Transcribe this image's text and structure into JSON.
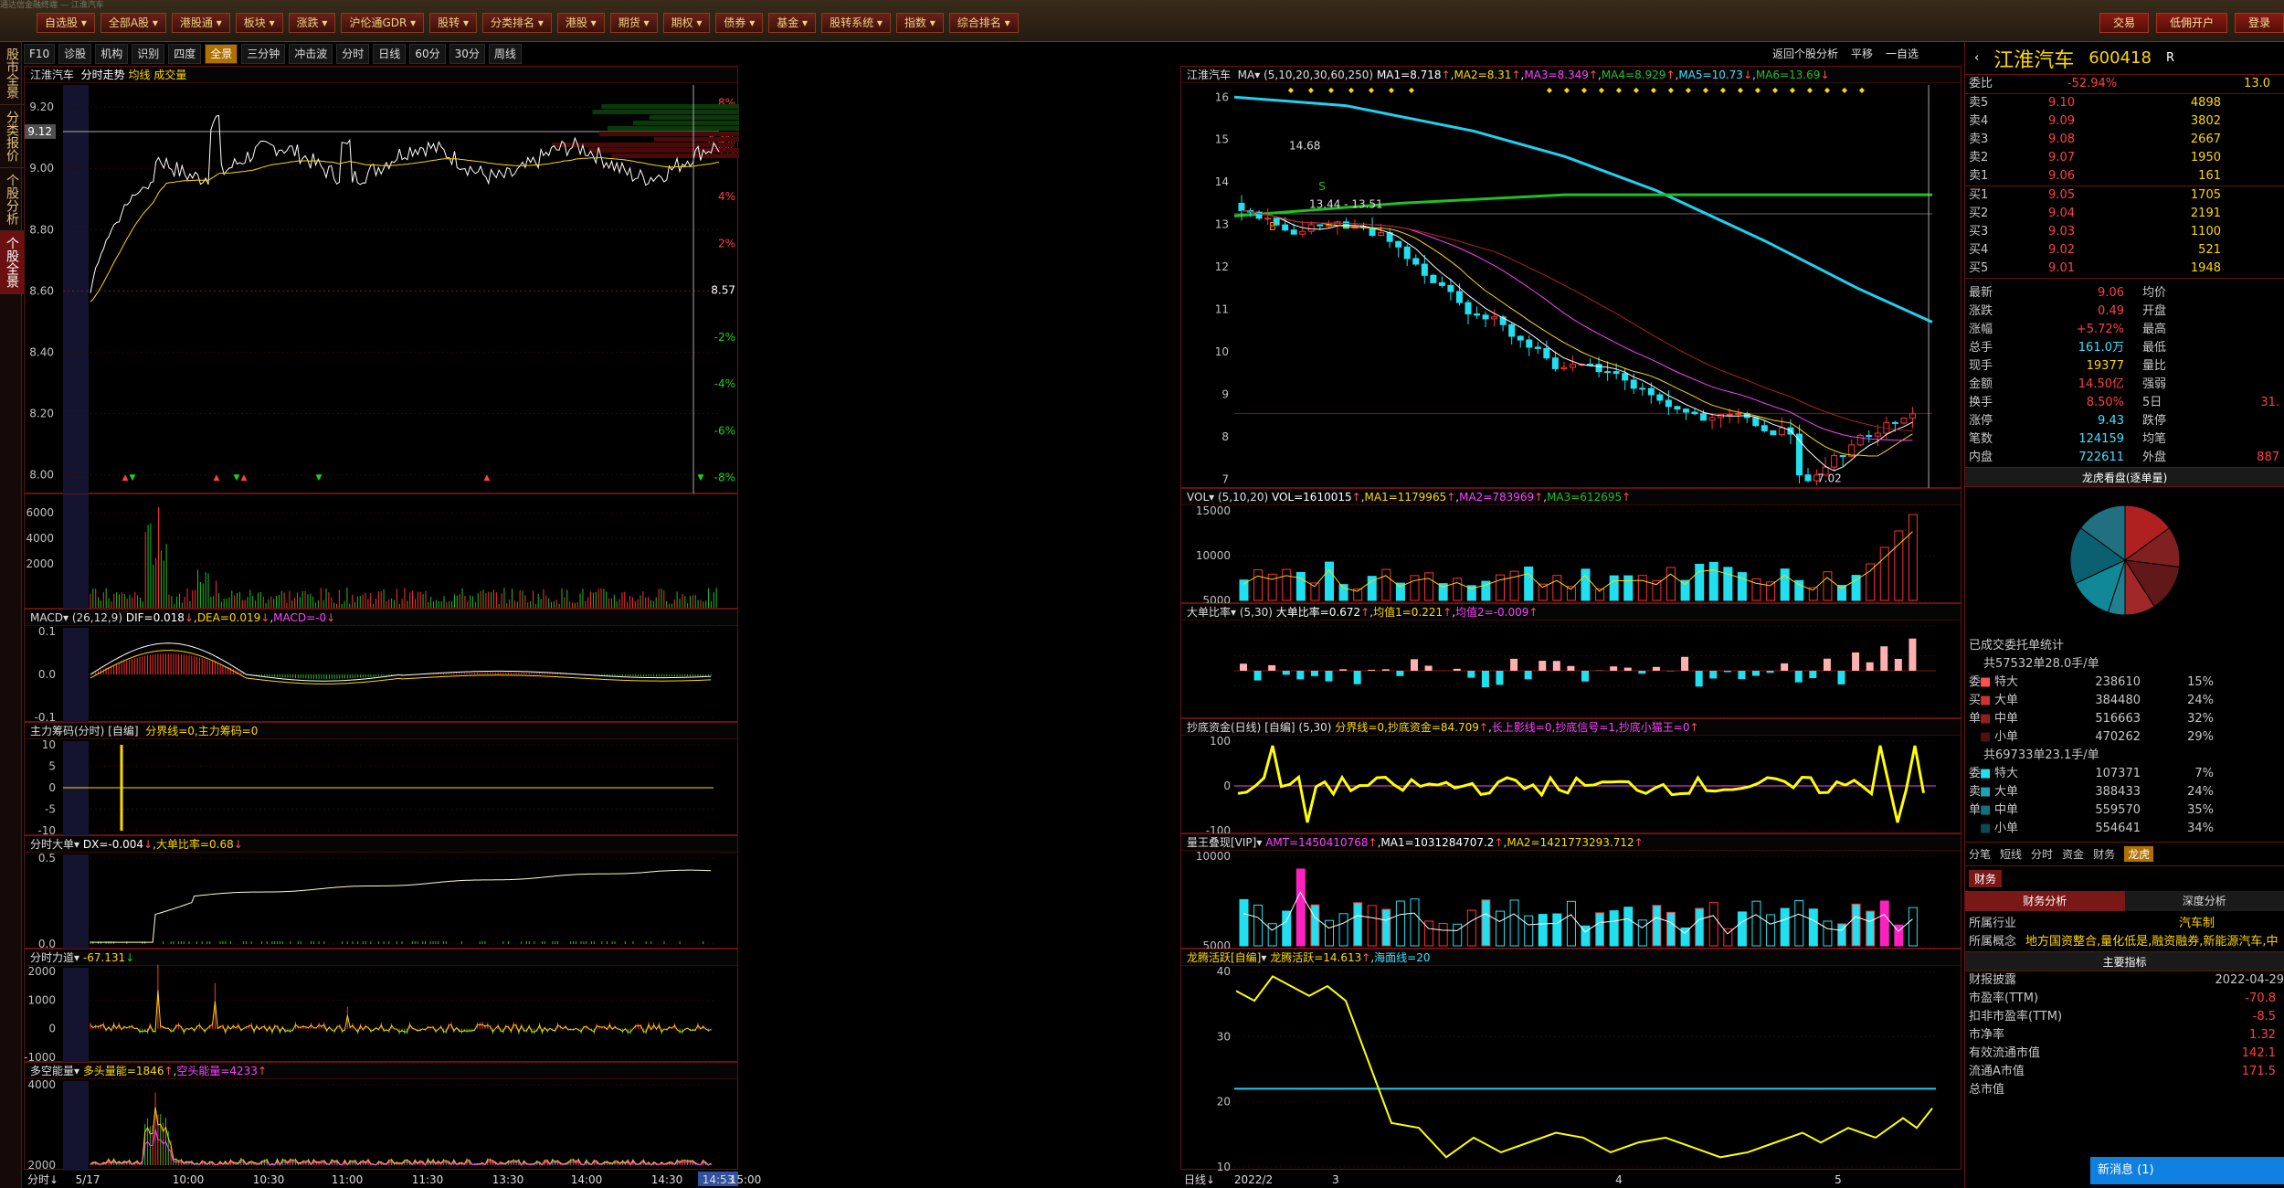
{
  "window_title": "通达信金融终端 — 江淮汽车",
  "menus": [
    "自选股",
    "全部A股",
    "港股通",
    "板块",
    "涨跌",
    "沪伦通GDR",
    "股转",
    "分类排名",
    "港股",
    "期货",
    "期权",
    "债券",
    "基金",
    "股转系统",
    "指数",
    "综合排名"
  ],
  "right_buttons": [
    "交易",
    "低佣开户",
    "登录"
  ],
  "left_tabs": [
    "股市全景",
    "分类报价",
    "个股分析",
    "个股全景"
  ],
  "toolbar": [
    "F10",
    "诊股",
    "机构",
    "识别",
    "四度",
    "全景",
    "三分钟",
    "冲击波",
    "分时",
    "日线",
    "60分",
    "30分",
    "周线"
  ],
  "toolbar_active": "全景",
  "k_toolbar": [
    "返回个股分析",
    "平移",
    "一自选"
  ],
  "intraday": {
    "title_stock": "江淮汽车",
    "title_mode": "分时走势",
    "title_extra": "均线 成交量",
    "prices": [
      "9.20",
      "9.12",
      "9.00",
      "8.80",
      "8.60",
      "8.40",
      "8.20",
      "8.00"
    ],
    "pct": [
      "8%",
      "6.4%",
      "6%",
      "4%",
      "2%",
      "8.57",
      "-2%",
      "-4%",
      "-6%",
      "-8%"
    ],
    "current_price": "9.12",
    "current_pct": "6.4%",
    "vol_ticks": [
      "6000",
      "4000",
      "2000"
    ],
    "time_labels": [
      "5/17",
      "10:00",
      "10:30",
      "11:00",
      "11:30",
      "13:30",
      "14:00",
      "14:30",
      "14:53",
      "15:00"
    ],
    "bottom_left": "分时"
  },
  "sub_panels": {
    "macd": {
      "name": "MACD",
      "params": "(26,12,9)",
      "dif": "DIF=0.018",
      "dea": "DEA=0.019",
      "macd": "MACD=-0"
    },
    "zhuli": {
      "name": "主力筹码(分时)",
      "type": "[自编]",
      "text": "分界线=0,主力筹码=0",
      "ticks": [
        "10",
        "5",
        "0",
        "-5",
        "-10"
      ]
    },
    "dadan": {
      "name": "分时大单",
      "dx": "DX=-0.004",
      "bili": "大单比率=0.68",
      "ticks": [
        "0.5",
        "0.0"
      ]
    },
    "lidao": {
      "name": "分时力道",
      "val": "-67.131",
      "ticks": [
        "2000",
        "1000",
        "0",
        "-1000"
      ]
    },
    "duokong": {
      "name": "多空能量",
      "duo": "多头量能=1846",
      "kong": "空头能量=4233",
      "ticks": [
        "4000",
        "2000"
      ]
    }
  },
  "kline": {
    "name": "江淮汽车",
    "ma_label": "MA",
    "ma_params": "(5,10,20,30,60,250)",
    "ma": [
      "MA1=8.718",
      "MA2=8.31",
      "MA3=8.349",
      "MA4=8.929",
      "MA5=10.73",
      "MA6=13.69"
    ],
    "yticks": [
      "16",
      "15",
      "14",
      "13",
      "12",
      "11",
      "10",
      "9",
      "8",
      "7"
    ],
    "high_label": "14.68",
    "low_label": "7.02",
    "range_label": "13.44 - 13.51",
    "b_label": "B",
    "s_label": "S",
    "x_labels": [
      "2022/2",
      "3",
      "4",
      "5"
    ],
    "bottom_left": "日线"
  },
  "k_sub": {
    "vol": {
      "name": "VOL",
      "params": "(5,10,20)",
      "vol": "VOL=1610015",
      "ma1": "MA1=1179965",
      "ma2": "MA2=783969",
      "ma3": "MA3=612695",
      "ticks": [
        "15000",
        "10000",
        "5000"
      ]
    },
    "dadan": {
      "name": "大单比率",
      "params": "(5,30)",
      "val": "大单比率=0.672",
      "j1": "均值1=0.221",
      "j2": "均值2=-0.009"
    },
    "chaodi": {
      "name": "抄底资金(日线)",
      "type": "[自编]",
      "params": "(5,30)",
      "text": "分界线=0,抄底资金=84.709",
      "ext": "长上影线=0,抄底信号=1,抄底小猫王=0",
      "ticks": [
        "100",
        "0",
        "-100"
      ]
    },
    "liangwang": {
      "name": "量王叠现[VIP]",
      "amt": "AMT=1450410768",
      "ma1": "MA1=1031284707.2",
      "ma2": "MA2=1421773293.712",
      "ticks": [
        "10000",
        "5000"
      ]
    },
    "longteng": {
      "name": "龙腾活跃[自编]",
      "text": "龙腾活跃=14.613",
      "hai": "海面线=20",
      "ticks": [
        "40",
        "30",
        "20",
        "10"
      ]
    }
  },
  "sidebar": {
    "name": "江淮汽车",
    "code": "600418",
    "flag": "R",
    "weibi_label": "委比",
    "weibi": "-52.94%",
    "weicha": "13.0",
    "asks": [
      [
        "卖5",
        "9.10",
        "4898"
      ],
      [
        "卖4",
        "9.09",
        "3802"
      ],
      [
        "卖3",
        "9.08",
        "2667"
      ],
      [
        "卖2",
        "9.07",
        "1950"
      ],
      [
        "卖1",
        "9.06",
        "161"
      ]
    ],
    "bids": [
      [
        "买1",
        "9.05",
        "1705"
      ],
      [
        "买2",
        "9.04",
        "2191"
      ],
      [
        "买3",
        "9.03",
        "1100"
      ],
      [
        "买4",
        "9.02",
        "521"
      ],
      [
        "买5",
        "9.01",
        "1948"
      ]
    ],
    "quote": [
      [
        "最新",
        "9.06",
        "均价",
        ""
      ],
      [
        "涨跌",
        "0.49",
        "开盘",
        ""
      ],
      [
        "涨幅",
        "+5.72%",
        "最高",
        ""
      ],
      [
        "总手",
        "161.0万",
        "最低",
        ""
      ],
      [
        "现手",
        "19377",
        "量比",
        ""
      ],
      [
        "金额",
        "14.50亿",
        "强弱",
        ""
      ],
      [
        "换手",
        "8.50%",
        "5日",
        "31."
      ],
      [
        "涨停",
        "9.43",
        "跌停",
        ""
      ],
      [
        "笔数",
        "124159",
        "均笔",
        ""
      ],
      [
        "内盘",
        "722611",
        "外盘",
        "887"
      ]
    ],
    "dragon_title": "龙虎看盘(逐单量)",
    "entrust_title": "已成交委托单统计",
    "buy_total": "共57532单28.0手/单",
    "buy": [
      [
        "委",
        "特大",
        "238610",
        "15%"
      ],
      [
        "买",
        "大单",
        "384480",
        "24%"
      ],
      [
        "单",
        "中单",
        "516663",
        "32%"
      ],
      [
        "",
        "小单",
        "470262",
        "29%"
      ]
    ],
    "sell_total": "共69733单23.1手/单",
    "sell": [
      [
        "委",
        "特大",
        "107371",
        "7%"
      ],
      [
        "卖",
        "大单",
        "388433",
        "24%"
      ],
      [
        "单",
        "中单",
        "559570",
        "35%"
      ],
      [
        "",
        "小单",
        "554641",
        "34%"
      ]
    ],
    "tabs": [
      "分笔",
      "短线",
      "分时",
      "资金",
      "财务",
      "龙虎"
    ],
    "tab_active": "龙虎",
    "fin_tab": "财务",
    "fin_sub": [
      "财务分析",
      "深度分析"
    ],
    "industry_label": "所属行业",
    "industry": "汽车制",
    "concept_label": "所属概念",
    "concept": "地方国资整合,量化低是,融资融券,新能源汽车,中",
    "main_index": "主要指标",
    "report_label": "财报披露",
    "report": "2022-04-29",
    "metrics": [
      [
        "市盈率(TTM)",
        "-70.8"
      ],
      [
        "扣非市盈率(TTM)",
        "-8.5"
      ],
      [
        "市净率",
        "1.32"
      ],
      [
        "有效流通市值",
        "142.1"
      ],
      [
        "流通A市值",
        "171.5"
      ],
      [
        "总市值",
        ""
      ]
    ],
    "news": "新消息 (1)"
  }
}
